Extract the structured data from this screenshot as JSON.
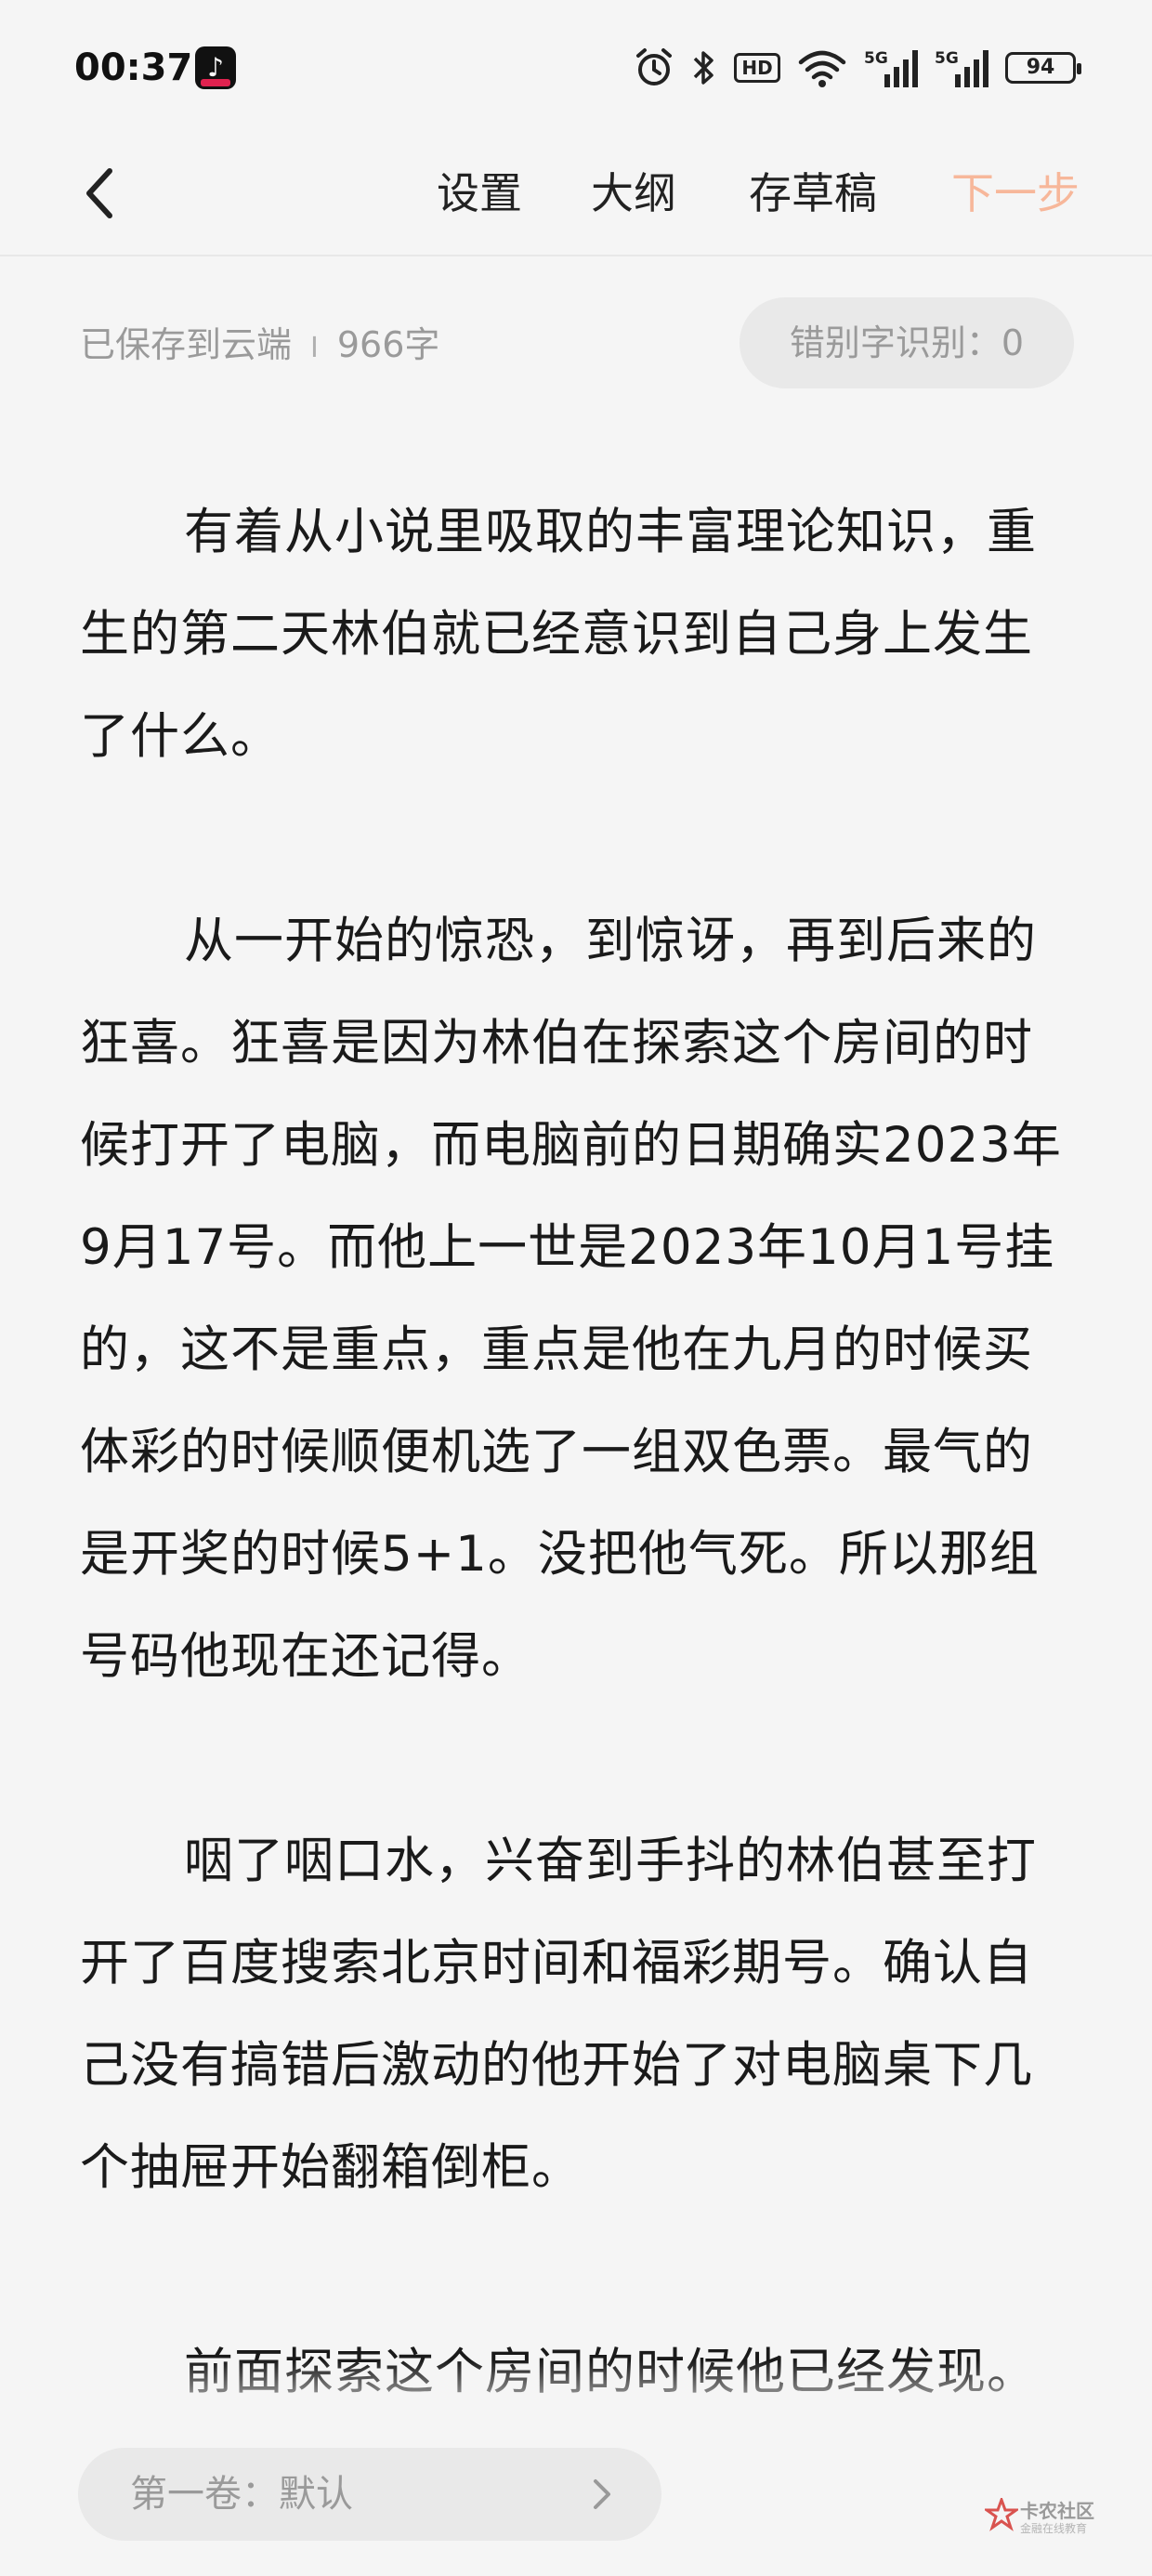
{
  "status_bar": {
    "time": "00:37",
    "hd_badge": "HD",
    "net_1": "5G",
    "net_2": "5G",
    "battery": "94"
  },
  "nav": {
    "settings": "设置",
    "outline": "大纲",
    "draft": "存草稿",
    "next": "下一步"
  },
  "meta": {
    "saved": "已保存到云端",
    "separator": "I",
    "word_count": "966字",
    "typo_check": "错别字识别：0"
  },
  "paragraphs": [
    "有着从小说里吸取的丰富理论知识，重生的第二天林伯就已经意识到自己身上发生了什么。",
    "从一开始的惊恐，到惊讶，再到后来的狂喜。狂喜是因为林伯在探索这个房间的时候打开了电脑，而电脑前的日期确实2023年9月17号。而他上一世是2023年10月1号挂的，这不是重点，重点是他在九月的时候买体彩的时候顺便机选了一组双色票。最气的是开奖的时候5+1。没把他气死。所以那组号码他现在还记得。",
    "咽了咽口水，兴奋到手抖的林伯甚至打开了百度搜索北京时间和福彩期号。确认自己没有搞错后激动的他开始了对电脑桌下几个抽屉开始翻箱倒柜。",
    "前面探索这个房间的时候他已经发现。这里居然没有任何值钱的东西，除了一台电"
  ],
  "volume": {
    "label": "第一卷：默认"
  },
  "watermark": {
    "text": "卡农社区",
    "sub": "金融在线教育"
  },
  "colors": {
    "accent_next": "#f7b79a",
    "background": "#f5f5f5",
    "pill_bg": "#e9e9e9",
    "muted_text": "#9a9a9a"
  },
  "icons": {
    "app": "tiktok-lite-icon",
    "alarm": "alarm-icon",
    "bluetooth": "bluetooth-icon",
    "wifi": "wifi-icon",
    "signal": "signal-icon",
    "back": "back-arrow-icon",
    "chevron": "chevron-right-icon"
  }
}
